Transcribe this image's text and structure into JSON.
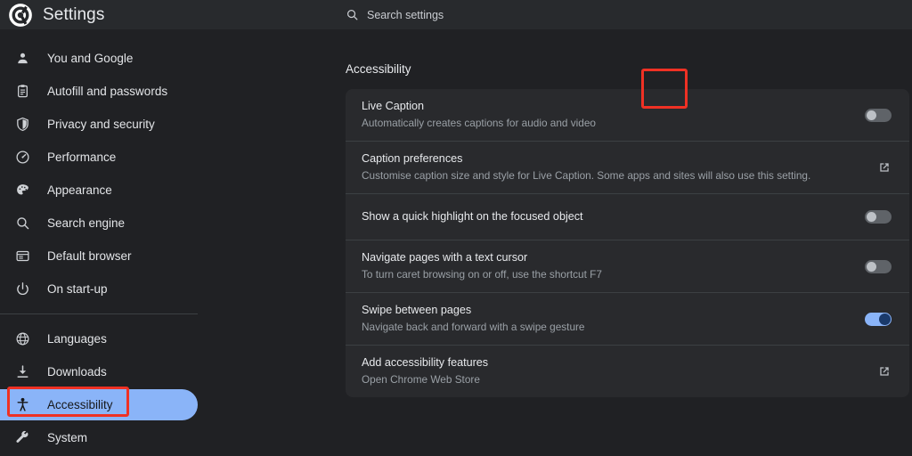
{
  "brand": {
    "title": "Settings",
    "logo_icon": "chrome-logo-icon"
  },
  "search": {
    "placeholder": "Search settings",
    "icon": "search-icon"
  },
  "sidebar": {
    "items": [
      {
        "label": "You and Google",
        "icon": "person-icon",
        "selected": false
      },
      {
        "label": "Autofill and passwords",
        "icon": "clipboard-icon",
        "selected": false
      },
      {
        "label": "Privacy and security",
        "icon": "shield-icon",
        "selected": false
      },
      {
        "label": "Performance",
        "icon": "speedometer-icon",
        "selected": false
      },
      {
        "label": "Appearance",
        "icon": "palette-icon",
        "selected": false
      },
      {
        "label": "Search engine",
        "icon": "magnifier-icon",
        "selected": false
      },
      {
        "label": "Default browser",
        "icon": "browser-window-icon",
        "selected": false
      },
      {
        "label": "On start-up",
        "icon": "power-icon",
        "selected": false
      },
      {
        "label": "Languages",
        "icon": "globe-icon",
        "selected": false
      },
      {
        "label": "Downloads",
        "icon": "download-icon",
        "selected": false
      },
      {
        "label": "Accessibility",
        "icon": "accessibility-icon",
        "selected": true
      },
      {
        "label": "System",
        "icon": "wrench-icon",
        "selected": false
      }
    ]
  },
  "main": {
    "section_title": "Accessibility",
    "rows": [
      {
        "title": "Live Caption",
        "subtitle": "Automatically creates captions for audio and video",
        "control": "toggle",
        "state": "off",
        "annotated": true
      },
      {
        "title": "Caption preferences",
        "subtitle": "Customise caption size and style for Live Caption. Some apps and sites will also use this setting.",
        "control": "external-link",
        "state": "",
        "annotated": false
      },
      {
        "title": "Show a quick highlight on the focused object",
        "subtitle": "",
        "control": "toggle",
        "state": "off",
        "annotated": false
      },
      {
        "title": "Navigate pages with a text cursor",
        "subtitle": "To turn caret browsing on or off, use the shortcut F7",
        "control": "toggle",
        "state": "off",
        "annotated": false
      },
      {
        "title": "Swipe between pages",
        "subtitle": "Navigate back and forward with a swipe gesture",
        "control": "toggle",
        "state": "on",
        "annotated": false
      },
      {
        "title": "Add accessibility features",
        "subtitle": "Open Chrome Web Store",
        "control": "external-link",
        "state": "",
        "annotated": false
      }
    ]
  },
  "colors": {
    "page_background": "#202124",
    "card_background": "#292a2d",
    "header_background": "#282a2d",
    "accent_blue": "#8ab4f8",
    "toggle_off_track": "#5f6368",
    "annotation_red": "#ef3124",
    "primary_text": "#e8eaed",
    "secondary_text": "#9aa0a6"
  }
}
